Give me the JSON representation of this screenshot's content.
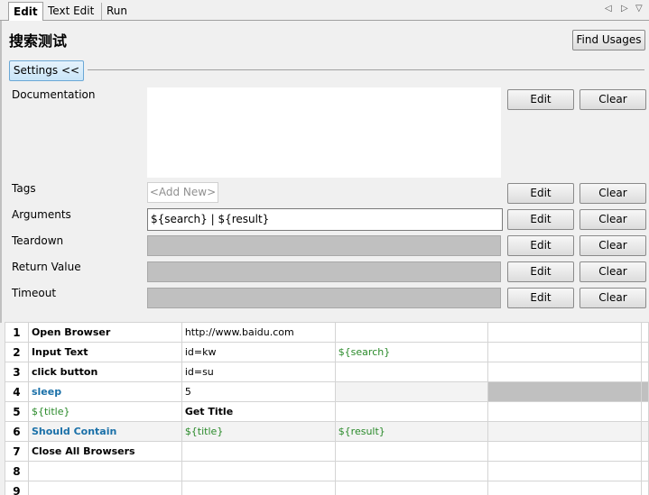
{
  "tabs": [
    "Edit",
    "Text Edit",
    "Run"
  ],
  "header": {
    "title": "搜索测试",
    "find_usages": "Find Usages"
  },
  "settings": {
    "toggle_label": "Settings <<",
    "edit_label": "Edit",
    "clear_label": "Clear",
    "documentation": {
      "label": "Documentation",
      "value": ""
    },
    "tags": {
      "label": "Tags",
      "placeholder": "<Add New>"
    },
    "arguments": {
      "label": "Arguments",
      "value": "${search} | ${result}"
    },
    "teardown": {
      "label": "Teardown"
    },
    "return_value": {
      "label": "Return Value"
    },
    "timeout": {
      "label": "Timeout"
    }
  },
  "grid": {
    "rows": [
      {
        "num": "1",
        "cells": [
          "Open Browser",
          "http://www.baidu.com",
          "",
          ""
        ]
      },
      {
        "num": "2",
        "cells": [
          "Input Text",
          "id=kw",
          "${search}",
          ""
        ]
      },
      {
        "num": "3",
        "cells": [
          "click button",
          "id=su",
          "",
          ""
        ]
      },
      {
        "num": "4",
        "cells": [
          "sleep",
          "5",
          "",
          ""
        ]
      },
      {
        "num": "5",
        "cells": [
          "${title}",
          "Get Title",
          "",
          ""
        ]
      },
      {
        "num": "6",
        "cells": [
          "Should Contain",
          "${title}",
          "${result}",
          ""
        ]
      },
      {
        "num": "7",
        "cells": [
          "Close All Browsers",
          "",
          "",
          ""
        ]
      },
      {
        "num": "8",
        "cells": [
          "",
          "",
          "",
          ""
        ]
      },
      {
        "num": "9",
        "cells": [
          "",
          "",
          "",
          ""
        ]
      }
    ]
  },
  "colors": {
    "keyword_blue": "#1a70a8",
    "variable_green": "#2a8a2a",
    "settings_button": "#c9e5f8"
  }
}
